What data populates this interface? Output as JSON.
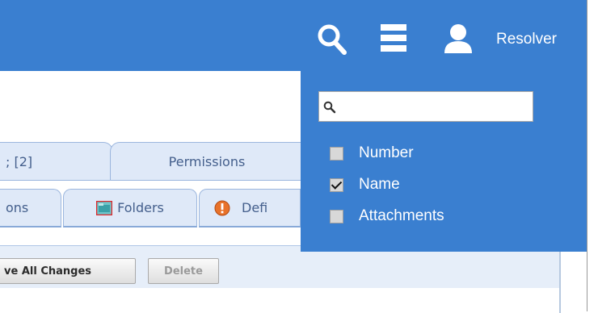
{
  "header": {
    "user_name": "Resolver",
    "icons": [
      "search-icon",
      "menu-icon",
      "user-icon"
    ],
    "color": "#3a7fd0"
  },
  "tabs": {
    "row1": [
      {
        "label": "; [2]"
      },
      {
        "label": "Permissions"
      }
    ],
    "row2": [
      {
        "label": "ons"
      },
      {
        "label": "Folders",
        "icon": "folder-icon"
      },
      {
        "label": "Defi",
        "icon": "warning-icon"
      }
    ]
  },
  "toolbar": {
    "save_label": "ve All Changes",
    "delete_label": "Delete"
  },
  "dropdown": {
    "search_value": "",
    "options": [
      {
        "label": "Number",
        "checked": false
      },
      {
        "label": "Name",
        "checked": true
      },
      {
        "label": "Attachments",
        "checked": false
      }
    ]
  }
}
